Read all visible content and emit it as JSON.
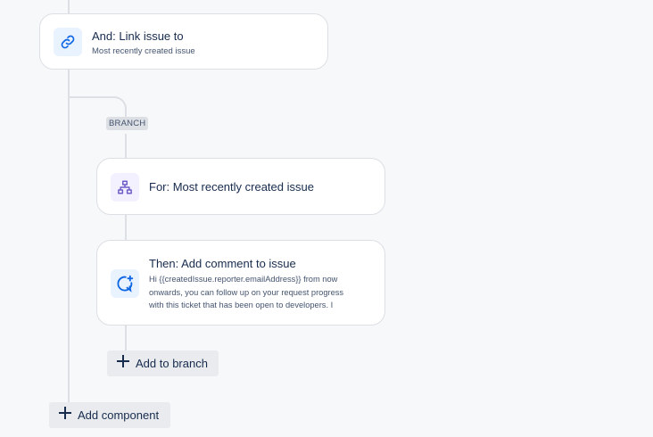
{
  "link_card": {
    "title": "And: Link issue to",
    "subtitle": "Most recently created issue",
    "icon": "link-icon"
  },
  "branch_badge": "BRANCH",
  "for_card": {
    "title": "For: Most recently created issue",
    "icon": "hierarchy-icon"
  },
  "comment_card": {
    "title": "Then: Add comment to issue",
    "description": "Hi {{createdIssue.reporter.emailAddress}} from now onwards, you can follow up on your request progress with this ticket that has been open to developers. I",
    "icon": "comment-add-icon"
  },
  "add_to_branch_label": "Add to branch",
  "add_component_label": "Add component",
  "colors": {
    "background": "#f7f8f9",
    "connector": "#dcdfe4",
    "link_accent": "#0c66e4",
    "branch_accent": "#6e5dc6"
  }
}
